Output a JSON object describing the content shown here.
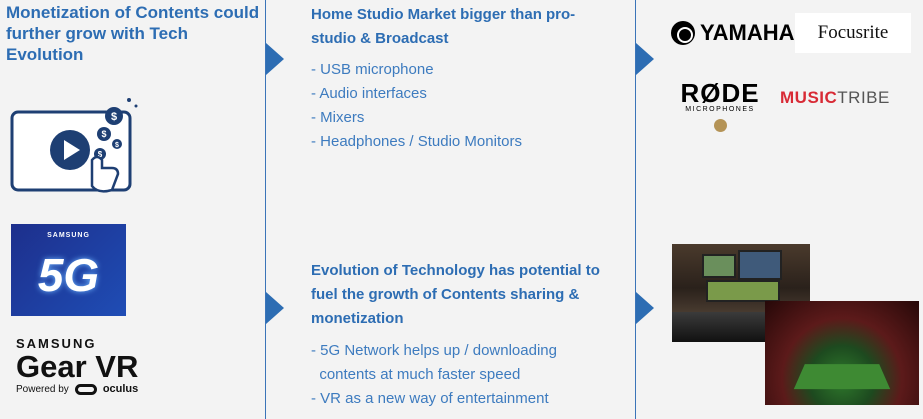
{
  "left": {
    "heading": "Monetization of Contents could further grow with Tech Evolution",
    "samsung_5g": {
      "brand": "SAMSUNG",
      "label": "5G"
    },
    "gear_vr": {
      "brand": "SAMSUNG",
      "product": "Gear VR",
      "powered_by": "Powered by",
      "partner": "oculus"
    }
  },
  "middle": {
    "section1": {
      "heading": "Home Studio Market bigger than pro-studio & Broadcast",
      "bullets": [
        "- USB microphone",
        "- Audio interfaces",
        "- Mixers",
        "- Headphones / Studio Monitors"
      ]
    },
    "section2": {
      "heading": "Evolution of Technology has potential to fuel the growth of Contents sharing & monetization",
      "bullets": [
        "- 5G Network helps up / downloading",
        "  contents at much faster speed",
        "- VR as a new way of entertainment"
      ]
    }
  },
  "right": {
    "logos": {
      "yamaha": "YAMAHA",
      "focusrite": "Focusrite",
      "rode": "RØDE",
      "rode_sub": "MICROPHONES",
      "music": "MUSIC",
      "tribe": "TRIBE"
    }
  },
  "colors": {
    "accent": "#2d6db3",
    "bullet_text": "#3d7bbf",
    "panel_bg": "#f3f3f3",
    "divider": "#3a74b8"
  }
}
